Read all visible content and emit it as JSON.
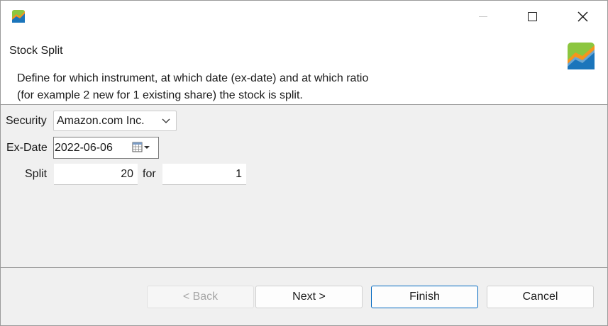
{
  "window": {
    "controls": {
      "minimize": "minimize-icon",
      "maximize": "maximize-icon",
      "close": "close-icon"
    }
  },
  "header": {
    "title": "Stock Split",
    "description_lines": [
      "Define for which instrument, at which date (ex-date) and at which ratio",
      "(for example 2 new for 1 existing share) the stock is split."
    ]
  },
  "form": {
    "security": {
      "label": "Security",
      "value": "Amazon.com Inc."
    },
    "ex_date": {
      "label": "Ex-Date",
      "value": "2022-06-06"
    },
    "split": {
      "label": "Split",
      "new_shares": "20",
      "for_label": "for",
      "existing_shares": "1"
    }
  },
  "buttons": {
    "back": "< Back",
    "next": "Next >",
    "finish": "Finish",
    "cancel": "Cancel"
  },
  "colors": {
    "accent": "#0067c0",
    "logo_green": "#8cc63f",
    "logo_orange": "#f7941d",
    "logo_blue": "#1b75bb"
  }
}
